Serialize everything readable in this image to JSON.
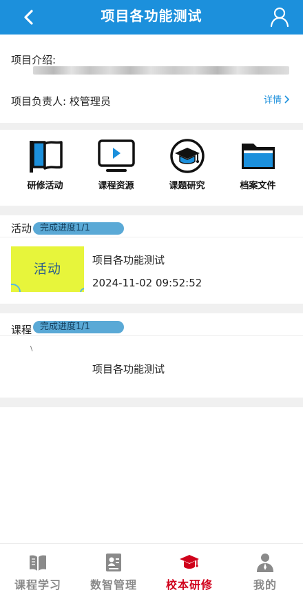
{
  "header": {
    "title": "项目各功能测试"
  },
  "intro": {
    "intro_label": "项目介绍:",
    "leader_label": "项目负责人: 校管理员",
    "details_label": "详情"
  },
  "features": [
    {
      "label": "研修活动",
      "icon": "flag-icon"
    },
    {
      "label": "课程资源",
      "icon": "video-player-icon"
    },
    {
      "label": "课题研究",
      "icon": "graduation-cap-icon"
    },
    {
      "label": "档案文件",
      "icon": "folder-icon"
    }
  ],
  "activity_section": {
    "title": "活动",
    "progress": "完成进度1/1",
    "item": {
      "thumb_text": "活动",
      "name": "项目各功能测试",
      "time": "2024-11-02 09:52:52"
    }
  },
  "course_section": {
    "title": "课程",
    "progress": "完成进度1/1",
    "tick": "\\",
    "item": {
      "name": "项目各功能测试"
    }
  },
  "tabbar": {
    "active": "校本研修",
    "tabs": [
      {
        "label": "课程学习",
        "icon": "book-icon"
      },
      {
        "label": "数智管理",
        "icon": "id-card-icon"
      },
      {
        "label": "校本研修",
        "icon": "graduation-cap-icon"
      },
      {
        "label": "我的",
        "icon": "person-icon"
      }
    ]
  },
  "colors": {
    "primary": "#1c90dc",
    "active_tab": "#d0021b",
    "progress_pill": "#5aa9d6",
    "thumb_bg": "#e7f53b"
  }
}
